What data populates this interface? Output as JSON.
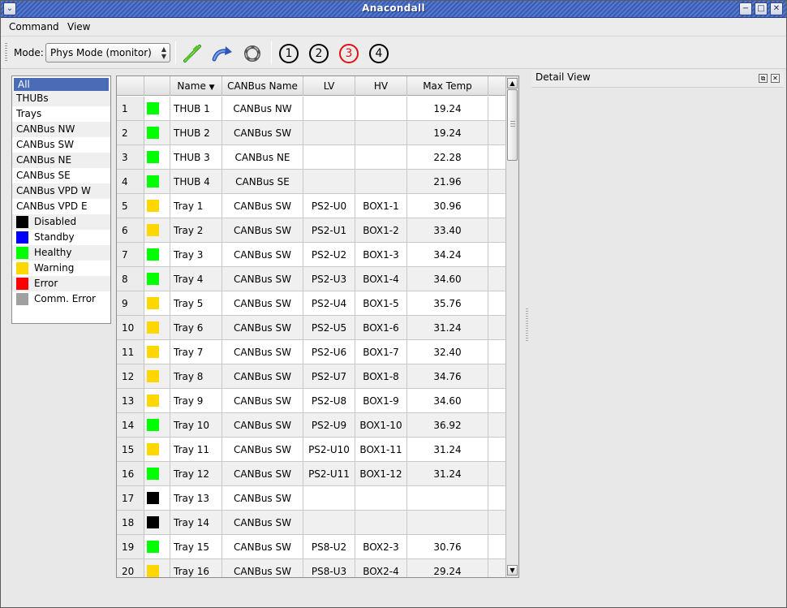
{
  "window": {
    "title": "Anacondall"
  },
  "menu": {
    "items": [
      "Command",
      "View"
    ]
  },
  "toolbar": {
    "mode_label": "Mode:",
    "mode_value": "Phys Mode (monitor)",
    "buttons": [
      "1",
      "2",
      "3",
      "4"
    ],
    "active_button": "3",
    "icons": [
      "connect-icon",
      "reconnect-icon",
      "refresh-icon"
    ]
  },
  "filter": {
    "items": [
      {
        "label": "All",
        "selected": true
      },
      {
        "label": "THUBs"
      },
      {
        "label": "Trays"
      },
      {
        "label": "CANBus NW"
      },
      {
        "label": "CANBus SW"
      },
      {
        "label": "CANBus NE"
      },
      {
        "label": "CANBus SE"
      },
      {
        "label": "CANBus VPD W"
      },
      {
        "label": "CANBus VPD E"
      },
      {
        "label": "Disabled",
        "color": "#000000"
      },
      {
        "label": "Standby",
        "color": "#0000ff"
      },
      {
        "label": "Healthy",
        "color": "#00ff00"
      },
      {
        "label": "Warning",
        "color": "#ffd700"
      },
      {
        "label": "Error",
        "color": "#ff0000"
      },
      {
        "label": "Comm. Error",
        "color": "#a0a0a0"
      }
    ]
  },
  "table": {
    "columns": [
      "",
      "",
      "Name",
      "CANBus Name",
      "LV",
      "HV",
      "Max Temp"
    ],
    "rows": [
      {
        "num": "1",
        "color": "#00ff00",
        "name": "THUB 1",
        "canbus": "CANBus NW",
        "lv": "",
        "hv": "",
        "temp": "19.24"
      },
      {
        "num": "2",
        "color": "#00ff00",
        "name": "THUB 2",
        "canbus": "CANBus SW",
        "lv": "",
        "hv": "",
        "temp": "19.24"
      },
      {
        "num": "3",
        "color": "#00ff00",
        "name": "THUB 3",
        "canbus": "CANBus NE",
        "lv": "",
        "hv": "",
        "temp": "22.28"
      },
      {
        "num": "4",
        "color": "#00ff00",
        "name": "THUB 4",
        "canbus": "CANBus SE",
        "lv": "",
        "hv": "",
        "temp": "21.96"
      },
      {
        "num": "5",
        "color": "#ffd700",
        "name": "Tray 1",
        "canbus": "CANBus SW",
        "lv": "PS2-U0",
        "hv": "BOX1-1",
        "temp": "30.96"
      },
      {
        "num": "6",
        "color": "#ffd700",
        "name": "Tray 2",
        "canbus": "CANBus SW",
        "lv": "PS2-U1",
        "hv": "BOX1-2",
        "temp": "33.40"
      },
      {
        "num": "7",
        "color": "#00ff00",
        "name": "Tray 3",
        "canbus": "CANBus SW",
        "lv": "PS2-U2",
        "hv": "BOX1-3",
        "temp": "34.24"
      },
      {
        "num": "8",
        "color": "#00ff00",
        "name": "Tray 4",
        "canbus": "CANBus SW",
        "lv": "PS2-U3",
        "hv": "BOX1-4",
        "temp": "34.60"
      },
      {
        "num": "9",
        "color": "#ffd700",
        "name": "Tray 5",
        "canbus": "CANBus SW",
        "lv": "PS2-U4",
        "hv": "BOX1-5",
        "temp": "35.76"
      },
      {
        "num": "10",
        "color": "#ffd700",
        "name": "Tray 6",
        "canbus": "CANBus SW",
        "lv": "PS2-U5",
        "hv": "BOX1-6",
        "temp": "31.24"
      },
      {
        "num": "11",
        "color": "#ffd700",
        "name": "Tray 7",
        "canbus": "CANBus SW",
        "lv": "PS2-U6",
        "hv": "BOX1-7",
        "temp": "32.40"
      },
      {
        "num": "12",
        "color": "#ffd700",
        "name": "Tray 8",
        "canbus": "CANBus SW",
        "lv": "PS2-U7",
        "hv": "BOX1-8",
        "temp": "34.76"
      },
      {
        "num": "13",
        "color": "#ffd700",
        "name": "Tray 9",
        "canbus": "CANBus SW",
        "lv": "PS2-U8",
        "hv": "BOX1-9",
        "temp": "34.60"
      },
      {
        "num": "14",
        "color": "#00ff00",
        "name": "Tray 10",
        "canbus": "CANBus SW",
        "lv": "PS2-U9",
        "hv": "BOX1-10",
        "temp": "36.92"
      },
      {
        "num": "15",
        "color": "#ffd700",
        "name": "Tray 11",
        "canbus": "CANBus SW",
        "lv": "PS2-U10",
        "hv": "BOX1-11",
        "temp": "31.24"
      },
      {
        "num": "16",
        "color": "#00ff00",
        "name": "Tray 12",
        "canbus": "CANBus SW",
        "lv": "PS2-U11",
        "hv": "BOX1-12",
        "temp": "31.24"
      },
      {
        "num": "17",
        "color": "#000000",
        "name": "Tray 13",
        "canbus": "CANBus SW",
        "lv": "",
        "hv": "",
        "temp": ""
      },
      {
        "num": "18",
        "color": "#000000",
        "name": "Tray 14",
        "canbus": "CANBus SW",
        "lv": "",
        "hv": "",
        "temp": ""
      },
      {
        "num": "19",
        "color": "#00ff00",
        "name": "Tray 15",
        "canbus": "CANBus SW",
        "lv": "PS8-U2",
        "hv": "BOX2-3",
        "temp": "30.76"
      },
      {
        "num": "20",
        "color": "#ffd700",
        "name": "Tray 16",
        "canbus": "CANBus SW",
        "lv": "PS8-U3",
        "hv": "BOX2-4",
        "temp": "29.24"
      }
    ]
  },
  "detail": {
    "title": "Detail View"
  }
}
